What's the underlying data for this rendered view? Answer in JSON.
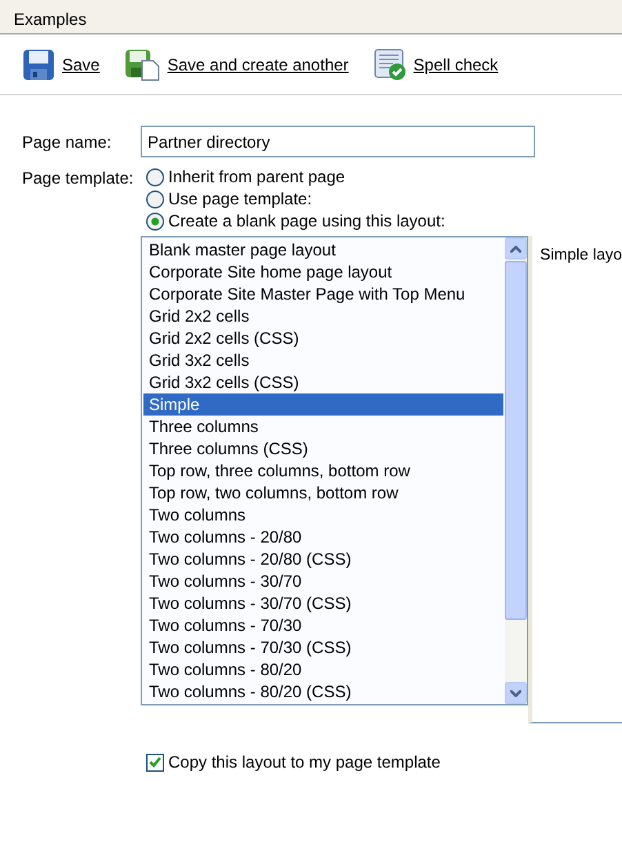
{
  "header": {
    "title": "Examples"
  },
  "toolbar": [
    {
      "kind": "save",
      "label": "Save"
    },
    {
      "kind": "save-new",
      "label": "Save and create another"
    },
    {
      "kind": "spell",
      "label": "Spell check"
    }
  ],
  "page_name": {
    "label": "Page name:",
    "value": "Partner directory"
  },
  "page_template": {
    "label": "Page template:",
    "options": [
      {
        "label": "Inherit from parent page",
        "selected": false
      },
      {
        "label": "Use page template:",
        "selected": false
      },
      {
        "label": "Create a blank page using this layout:",
        "selected": true
      }
    ]
  },
  "layouts": [
    {
      "label": "Blank master page layout",
      "selected": false
    },
    {
      "label": "Corporate Site home page layout",
      "selected": false
    },
    {
      "label": "Corporate Site Master Page with Top Menu",
      "selected": false
    },
    {
      "label": "Grid 2x2 cells",
      "selected": false
    },
    {
      "label": "Grid 2x2 cells (CSS)",
      "selected": false
    },
    {
      "label": "Grid 3x2 cells",
      "selected": false
    },
    {
      "label": "Grid 3x2 cells (CSS)",
      "selected": false
    },
    {
      "label": "Simple",
      "selected": true
    },
    {
      "label": "Three columns",
      "selected": false
    },
    {
      "label": "Three columns (CSS)",
      "selected": false
    },
    {
      "label": "Top row, three columns, bottom row",
      "selected": false
    },
    {
      "label": "Top row, two columns, bottom row",
      "selected": false
    },
    {
      "label": "Two columns",
      "selected": false
    },
    {
      "label": "Two columns - 20/80",
      "selected": false
    },
    {
      "label": "Two columns - 20/80 (CSS)",
      "selected": false
    },
    {
      "label": "Two columns - 30/70",
      "selected": false
    },
    {
      "label": "Two columns - 30/70 (CSS)",
      "selected": false
    },
    {
      "label": "Two columns - 70/30",
      "selected": false
    },
    {
      "label": "Two columns - 70/30 (CSS)",
      "selected": false
    },
    {
      "label": "Two columns - 80/20",
      "selected": false
    },
    {
      "label": "Two columns - 80/20 (CSS)",
      "selected": false
    }
  ],
  "preview": {
    "text": "Simple layo"
  },
  "copy_layout": {
    "label": "Copy this layout to my page template",
    "checked": true
  }
}
